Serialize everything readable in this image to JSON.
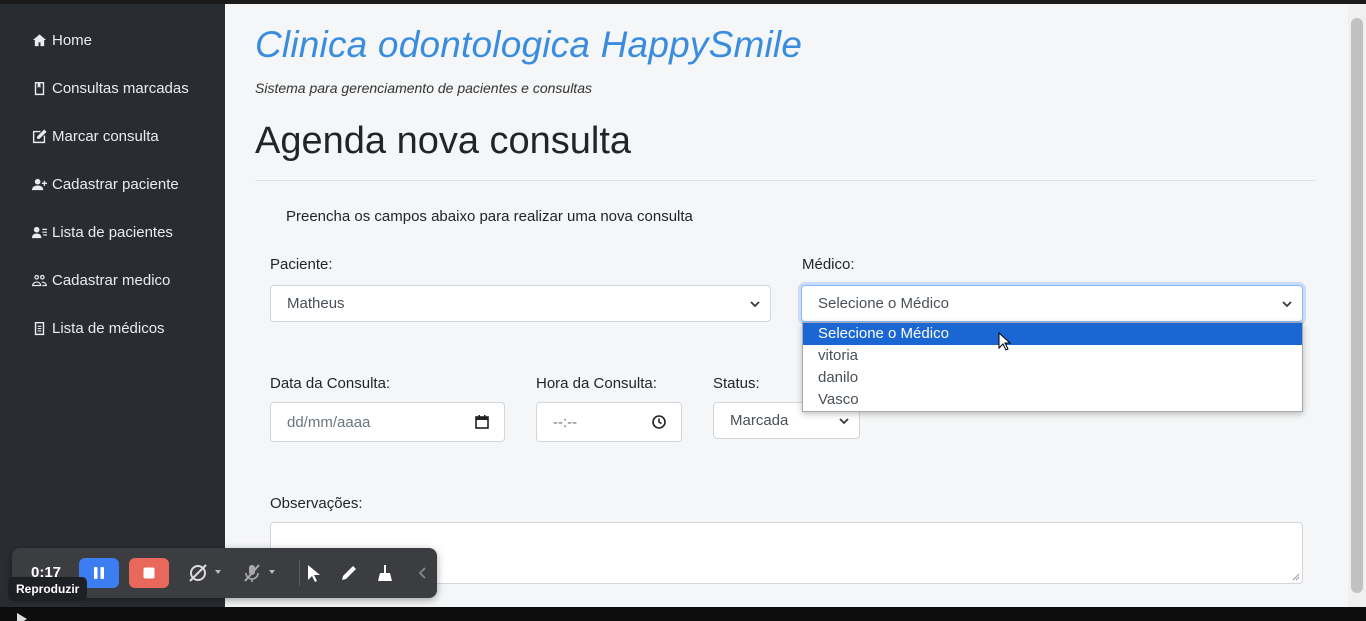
{
  "sidebar": {
    "items": [
      {
        "label": "Home",
        "icon": "home-icon"
      },
      {
        "label": "Consultas marcadas",
        "icon": "book-icon"
      },
      {
        "label": "Marcar consulta",
        "icon": "edit-icon"
      },
      {
        "label": "Cadastrar paciente",
        "icon": "user-plus-icon"
      },
      {
        "label": "Lista de pacientes",
        "icon": "user-list-icon"
      },
      {
        "label": "Cadastrar medico",
        "icon": "users-icon"
      },
      {
        "label": "Lista de médicos",
        "icon": "document-icon"
      }
    ]
  },
  "header": {
    "brand": "Clinica odontologica HappySmile",
    "subtitle": "Sistema para gerenciamento de pacientes e consultas",
    "title": "Agenda nova consulta"
  },
  "form": {
    "instructions": "Preencha os campos abaixo para realizar uma nova consulta",
    "paciente": {
      "label": "Paciente:",
      "value": "Matheus"
    },
    "medico": {
      "label": "Médico:",
      "value": "Selecione o Médico",
      "options": [
        "Selecione o Médico",
        "vitoria",
        "danilo",
        "Vasco"
      ],
      "selected_index": 0
    },
    "data": {
      "label": "Data da Consulta:",
      "placeholder": "dd/mm/aaaa"
    },
    "hora": {
      "label": "Hora da Consulta:",
      "placeholder": "--:--"
    },
    "status": {
      "label": "Status:",
      "value": "Marcada"
    },
    "observacoes": {
      "label": "Observações:",
      "value": ""
    }
  },
  "recorder": {
    "time": "0:17",
    "tooltip": "Reproduzir"
  },
  "colors": {
    "sidebar_bg": "#292d32",
    "brand": "#3a8dde",
    "dropdown_highlight": "#1a66d2",
    "pause_button": "#3d7df2",
    "stop_button": "#e8695c"
  }
}
